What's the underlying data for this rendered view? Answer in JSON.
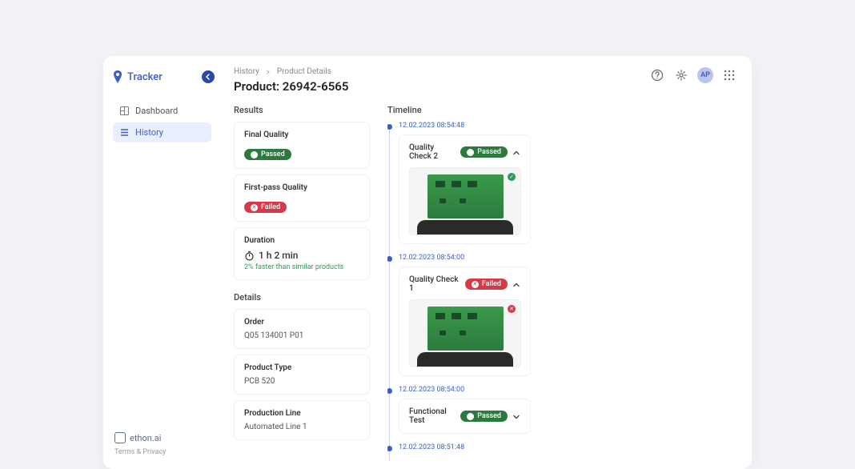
{
  "app_name": "Tracker",
  "sidebar": {
    "items": [
      {
        "label": "Dashboard"
      },
      {
        "label": "History"
      }
    ]
  },
  "footer": {
    "brand": "ethon.ai",
    "terms": "Terms & Privacy"
  },
  "breadcrumb": {
    "parent": "History",
    "current": "Product Details"
  },
  "page_title": "Product: 26942-6565",
  "avatar_initials": "AP",
  "results": {
    "title": "Results",
    "final_quality": {
      "label": "Final Quality",
      "status": "Passed"
    },
    "first_pass": {
      "label": "First-pass Quality",
      "status": "Failed"
    },
    "duration": {
      "label": "Duration",
      "value": "1 h 2 min",
      "note": "2% faster than similar products"
    }
  },
  "details": {
    "title": "Details",
    "order": {
      "label": "Order",
      "value": "Q05 134001 P01"
    },
    "product_type": {
      "label": "Product Type",
      "value": "PCB 520"
    },
    "production_line": {
      "label": "Production Line",
      "value": "Automated Line 1"
    }
  },
  "timeline": {
    "title": "Timeline",
    "items": [
      {
        "time": "12.02.2023 08:54:48",
        "title": "Quality Check 2",
        "status": "Passed",
        "expanded": true,
        "image_status": "ok"
      },
      {
        "time": "12.02.2023 08:54:00",
        "title": "Quality Check 1",
        "status": "Failed",
        "expanded": true,
        "image_status": "bad"
      },
      {
        "time": "12.02.2023 08:54:00",
        "title": "Functional Test",
        "status": "Passed",
        "expanded": false
      },
      {
        "time": "12.02.2023 08:51:48"
      }
    ]
  }
}
